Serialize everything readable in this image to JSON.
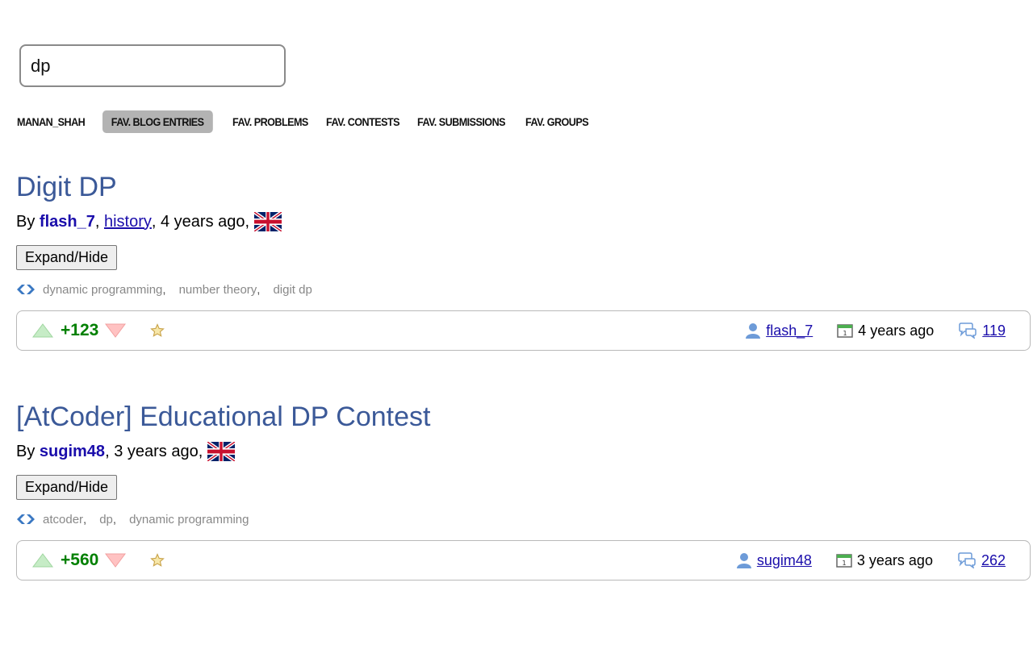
{
  "search": {
    "value": "dp"
  },
  "tabs": [
    {
      "label": "MANAN_SHAH",
      "active": false
    },
    {
      "label": "FAV. BLOG ENTRIES",
      "active": true
    },
    {
      "label": "FAV. PROBLEMS",
      "active": false
    },
    {
      "label": "FAV. CONTESTS",
      "active": false
    },
    {
      "label": "FAV. SUBMISSIONS",
      "active": false
    },
    {
      "label": "FAV. GROUPS",
      "active": false
    }
  ],
  "entries": [
    {
      "title": "Digit DP",
      "by_label": "By",
      "author": "flash_7",
      "author_color": "#0033cc",
      "history_label": "history",
      "age": "4 years ago",
      "expand_label": "Expand/Hide",
      "tags": [
        "dynamic programming",
        "number theory",
        "digit dp"
      ],
      "rating": "+123",
      "footer_author": "flash_7",
      "footer_age": "4 years ago",
      "comments": "119"
    },
    {
      "title": "[AtCoder] Educational DP Contest",
      "by_label": "By",
      "author": "sugim48",
      "author_color": "#ff0000",
      "age": "3 years ago",
      "expand_label": "Expand/Hide",
      "tags": [
        "atcoder",
        "dp",
        "dynamic programming"
      ],
      "rating": "+560",
      "footer_author": "sugim48",
      "footer_age": "3 years ago",
      "comments": "262"
    }
  ],
  "icons": {
    "tag": "tag-icon",
    "vote_up": "triangle-up-icon",
    "vote_down": "triangle-down-icon",
    "favourite": "star-icon",
    "user": "user-icon",
    "date": "calendar-icon",
    "comments": "comments-icon",
    "flag": "uk-flag-icon"
  },
  "colors": {
    "title": "#3b5998",
    "rating_positive": "#008000",
    "link": "#1a0dab"
  }
}
